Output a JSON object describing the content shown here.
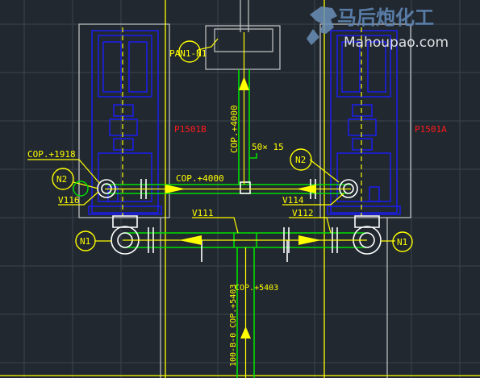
{
  "drawing": {
    "colors": {
      "background": "#212830",
      "grid": "#3a444e",
      "frame": "#c8c8c8",
      "equipment": "#1c1cff",
      "pipe": "#00e000",
      "annotation": "#ffff00",
      "tag": "#ff1a1a",
      "axis_yellow": "#ffff00",
      "center_white": "#ffffff"
    },
    "labels": {
      "pan": "PAN1-N1",
      "pump_b": "P1501B",
      "pump_a": "P1501A",
      "cop_1918": "COP.+1918",
      "cop_4000_h": "COP.+4000",
      "cop_4000_v": "COP.+4000",
      "cop_5403": "COP.+5403",
      "pipe_size": "50× 15",
      "line_vertical": "100-B-0 COP.+5403",
      "v116": "V116",
      "v114": "V114",
      "v111": "V111",
      "v112": "V112",
      "n2_left": "N2",
      "n2_right": "N2",
      "n1_left": "N1",
      "n1_right": "N1"
    },
    "watermark": {
      "cn": "马后炮化工",
      "en": "Mahoupao.com",
      "logo_icon": "horse-icon"
    }
  }
}
